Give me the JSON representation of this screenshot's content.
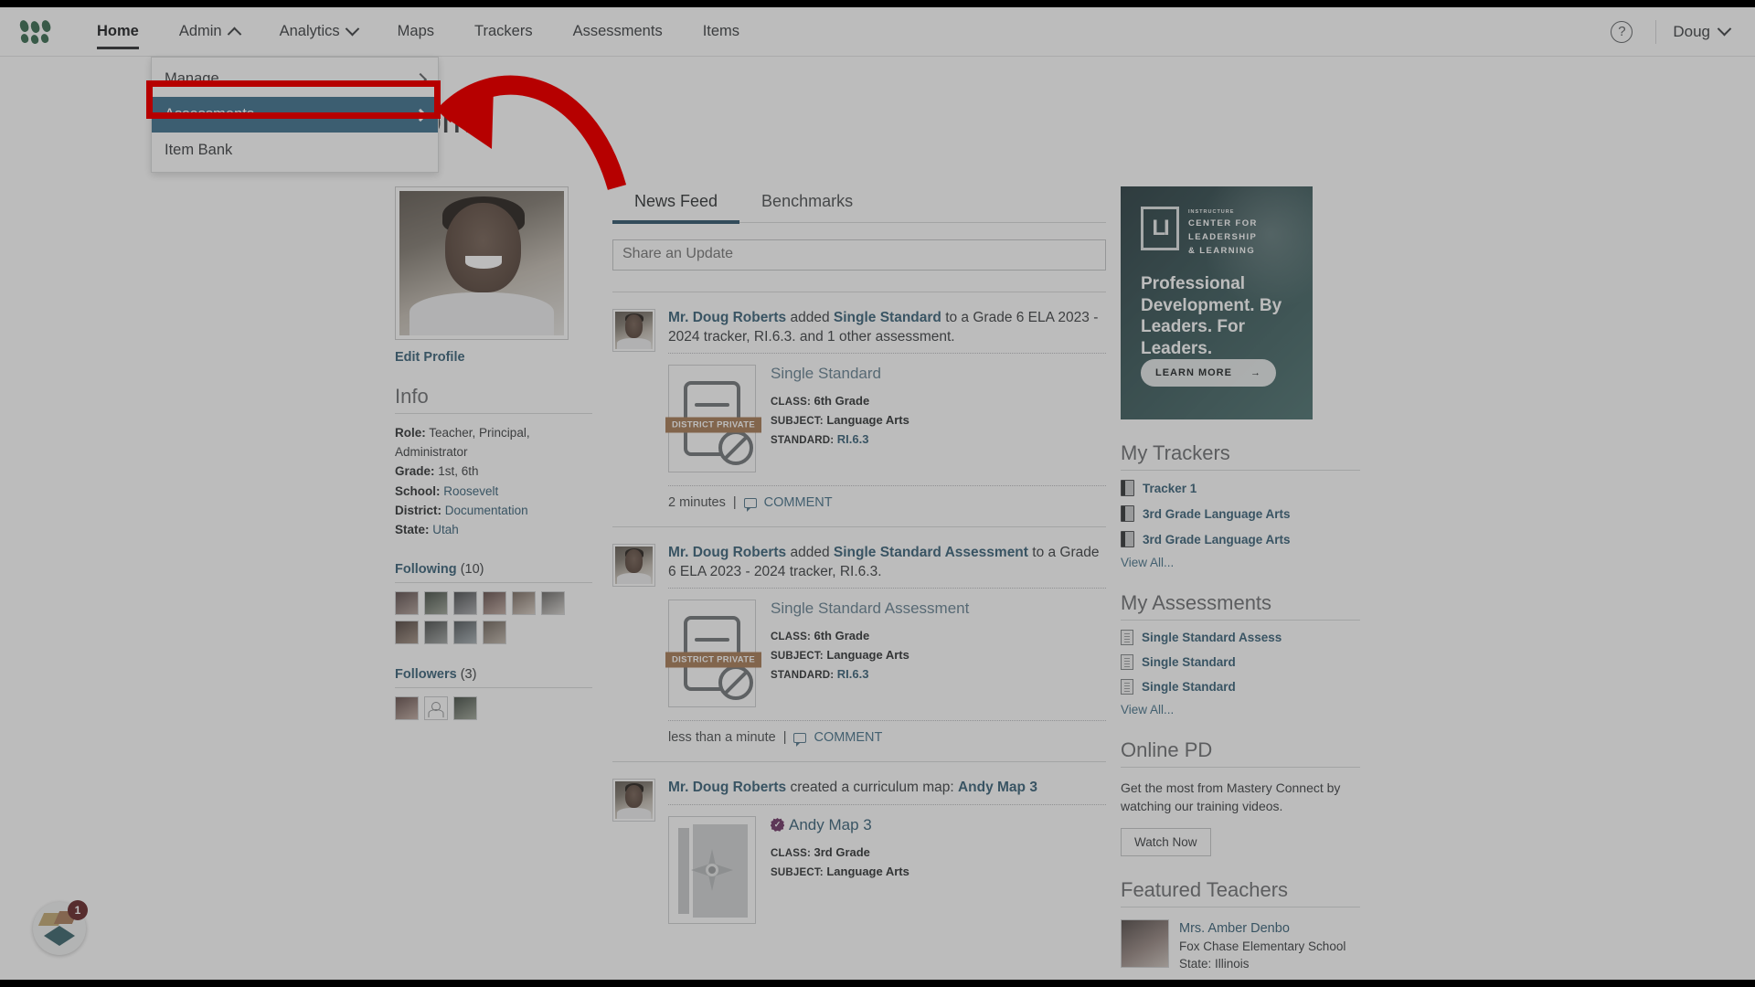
{
  "nav": {
    "logo_name": "mastery-connect-logo",
    "items": [
      {
        "label": "Home",
        "active": true,
        "caret": ""
      },
      {
        "label": "Admin",
        "active": false,
        "caret": "up"
      },
      {
        "label": "Analytics",
        "active": false,
        "caret": "down"
      },
      {
        "label": "Maps",
        "active": false,
        "caret": ""
      },
      {
        "label": "Trackers",
        "active": false,
        "caret": ""
      },
      {
        "label": "Assessments",
        "active": false,
        "caret": ""
      },
      {
        "label": "Items",
        "active": false,
        "caret": ""
      }
    ],
    "help_glyph": "?",
    "user_label": "Doug"
  },
  "dropdown": {
    "items": [
      {
        "label": "Manage",
        "selected": false
      },
      {
        "label": "Assessments",
        "selected": true
      },
      {
        "label": "Item Bank",
        "selected": false
      }
    ]
  },
  "annotation": {
    "highlight_color": "#b60000",
    "arrow_color": "#b60000"
  },
  "page": {
    "title": "Home"
  },
  "profile": {
    "edit_label": "Edit Profile",
    "info_title": "Info",
    "info": [
      {
        "key": "Role:",
        "value": "Teacher, Principal, Administrator",
        "link": false
      },
      {
        "key": "Grade:",
        "value": "1st, 6th",
        "link": false
      },
      {
        "key": "School:",
        "value": "Roosevelt",
        "link": true
      },
      {
        "key": "District:",
        "value": "Documentation",
        "link": true
      },
      {
        "key": "State:",
        "value": "Utah",
        "link": true
      }
    ],
    "following_label": "Following",
    "following_count": "(10)",
    "followers_label": "Followers",
    "followers_count": "(3)"
  },
  "feed": {
    "tabs": [
      {
        "label": "News Feed",
        "active": true
      },
      {
        "label": "Benchmarks",
        "active": false
      }
    ],
    "share_placeholder": "Share an Update",
    "posts": [
      {
        "author": "Mr. Doug Roberts",
        "action": " added ",
        "object": "Single Standard",
        "tail": " to a Grade 6 ELA 2023 - 2024 tracker, RI.6.3. and 1 other assessment.",
        "card_title": "Single Standard",
        "badge": "DISTRICT PRIVATE",
        "meta": [
          {
            "key": "CLASS:",
            "value": "6th Grade",
            "link": false
          },
          {
            "key": "SUBJECT:",
            "value": "Language Arts",
            "link": false
          },
          {
            "key": "STANDARD:",
            "value": "RI.6.3",
            "link": true
          }
        ],
        "time": "2 minutes",
        "separator": "|",
        "comment": "COMMENT",
        "thumb": "assessment"
      },
      {
        "author": "Mr. Doug Roberts",
        "action": " added ",
        "object": "Single Standard Assessment",
        "tail": " to a Grade 6 ELA 2023 - 2024 tracker, RI.6.3.",
        "card_title": "Single Standard Assessment",
        "badge": "DISTRICT PRIVATE",
        "meta": [
          {
            "key": "CLASS:",
            "value": "6th Grade",
            "link": false
          },
          {
            "key": "SUBJECT:",
            "value": "Language Arts",
            "link": false
          },
          {
            "key": "STANDARD:",
            "value": "RI.6.3",
            "link": true
          }
        ],
        "time": "less than a minute",
        "separator": "|",
        "comment": "COMMENT",
        "thumb": "assessment"
      },
      {
        "author": "Mr. Doug Roberts",
        "action": " created a curriculum map: ",
        "object": "Andy Map 3",
        "tail": "",
        "card_title": "Andy Map 3",
        "badge": "",
        "meta": [
          {
            "key": "CLASS:",
            "value": "3rd Grade",
            "link": false
          },
          {
            "key": "SUBJECT:",
            "value": "Language Arts",
            "link": false
          }
        ],
        "time": "",
        "separator": "",
        "comment": "",
        "thumb": "map"
      }
    ]
  },
  "ad": {
    "brand_tiny": "INSTRUCTURE",
    "brand_lines": [
      "CENTER FOR",
      "LEADERSHIP",
      "& LEARNING"
    ],
    "headline": "Professional Development. By Leaders. For Leaders.",
    "cta": "LEARN MORE",
    "cta_arrow": "→"
  },
  "trackers": {
    "title": "My Trackers",
    "items": [
      "Tracker 1",
      "3rd Grade Language Arts",
      "3rd Grade Language Arts"
    ],
    "view_all": "View All..."
  },
  "assessments": {
    "title": "My Assessments",
    "items": [
      "Single Standard Assess",
      "Single Standard",
      "Single Standard"
    ],
    "view_all": "View All..."
  },
  "online_pd": {
    "title": "Online PD",
    "text": "Get the most from Mastery Connect by watching our training videos.",
    "button": "Watch Now"
  },
  "featured": {
    "title": "Featured Teachers",
    "teacher": {
      "name": "Mrs. Amber Denbo",
      "school": "Fox Chase Elementary School",
      "state": "State: Illinois"
    }
  },
  "pendo": {
    "count": "1"
  }
}
